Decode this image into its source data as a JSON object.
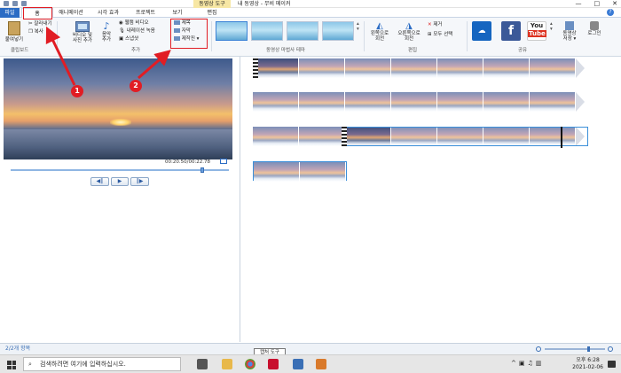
{
  "window": {
    "context_tools": "동영상 도구",
    "title": "내 동영상 - 무비 메이커",
    "controls": [
      "—",
      "□",
      "✕"
    ]
  },
  "tabs": {
    "file": "파일",
    "home": "홈",
    "animation": "애니메이션",
    "visual_effects": "시각 효과",
    "project": "프로젝트",
    "view": "보기",
    "edit": "편집"
  },
  "ribbon": {
    "clipboard": {
      "paste": "붙여넣기",
      "cut": "잘라내기",
      "copy": "복사",
      "label": "클립보드"
    },
    "add": {
      "add_videos": "비디오 및",
      "add_videos2": "사진 추가",
      "add_music": "음악",
      "add_music2": "추가",
      "webcam": "웹캠 비디오",
      "narration": "내레이션 녹음",
      "snapshot": "스냅샷",
      "label": "추가"
    },
    "text": {
      "title": "제목",
      "caption": "자막",
      "credits": "제작진"
    },
    "themes_label": "동영상 마법사 테마",
    "editing": {
      "rotate_left": "왼쪽으로",
      "rotate_left2": "회전",
      "rotate_right": "오른쪽으로",
      "rotate_right2": "회전",
      "remove": "제거",
      "select_all": "모두 선택",
      "label": "편집"
    },
    "share": {
      "youtube_top": "You",
      "youtube_bottom": "Tube",
      "onedrive_label": "OneDrive",
      "facebook_label": "f",
      "save_movie": "동영상",
      "save_movie2": "저장",
      "label": "공유"
    },
    "signin": "로그인"
  },
  "preview": {
    "timecode": "00:20.50/00:22.78"
  },
  "playback": {
    "prev": "◀‖",
    "play": "▶",
    "next": "‖▶"
  },
  "status": {
    "items": "2/2개 항목",
    "tooltip": "캡처 도구"
  },
  "taskbar": {
    "search_placeholder": "검색하려면 여기에 입력하십시오.",
    "time": "오후 6:28",
    "date": "2021-02-06"
  },
  "annotations": {
    "badge1": "1",
    "badge2": "2"
  },
  "colors": {
    "accent": "#2b6cc4",
    "annotation": "#e11d24",
    "selection": "#3b8fd9"
  }
}
